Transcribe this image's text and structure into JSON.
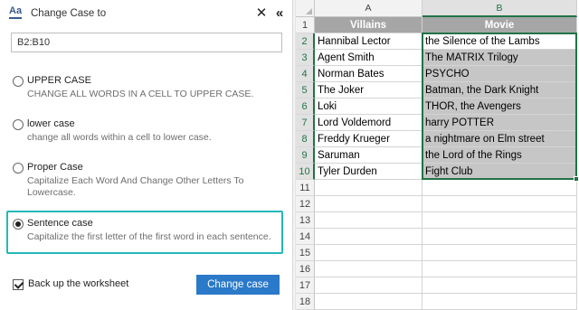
{
  "pane": {
    "title": "Change Case to",
    "icon_top": "Aa",
    "close_icon": "✕",
    "collapse_icon": "«",
    "range_value": "B2:B10",
    "options": [
      {
        "label": "UPPER CASE",
        "desc": "CHANGE ALL WORDS IN A CELL TO UPPER CASE.",
        "selected": false
      },
      {
        "label": "lower case",
        "desc": "change all words within a cell to lower case.",
        "selected": false
      },
      {
        "label": "Proper Case",
        "desc": "Capitalize Each Word And Change Other Letters To Lowercase.",
        "selected": false
      },
      {
        "label": "Sentence case",
        "desc": "Capitalize the first letter of the first word in each sentence.",
        "selected": true
      }
    ],
    "backup_label": "Back up the worksheet",
    "backup_checked": true,
    "change_button": "Change case",
    "accent_color": "#2b79c9",
    "highlight_color": "#25b8b8"
  },
  "sheet": {
    "columns": [
      "A",
      "B"
    ],
    "selected_column": "B",
    "rows": [
      "1",
      "2",
      "3",
      "4",
      "5",
      "6",
      "7",
      "8",
      "9",
      "10",
      "11",
      "12",
      "13",
      "14",
      "15",
      "16",
      "17",
      "18"
    ],
    "header": {
      "a": "Villains",
      "b": "Movie"
    },
    "data": [
      {
        "a": "Hannibal Lector",
        "b": "the Silence of the Lambs"
      },
      {
        "a": "Agent Smith",
        "b": "The MATRIX Trilogy"
      },
      {
        "a": "Norman Bates",
        "b": "PSYCHO"
      },
      {
        "a": "The Joker",
        "b": "Batman, the Dark Knight"
      },
      {
        "a": "Loki",
        "b": "THOR, the Avengers"
      },
      {
        "a": "Lord Voldemord",
        "b": "harry POTTER"
      },
      {
        "a": "Freddy Krueger",
        "b": "a nightmare on Elm street"
      },
      {
        "a": "Saruman",
        "b": "the Lord of the Rings"
      },
      {
        "a": "Tyler Durden",
        "b": "Fight Club"
      }
    ],
    "selection_color": "#217346"
  }
}
